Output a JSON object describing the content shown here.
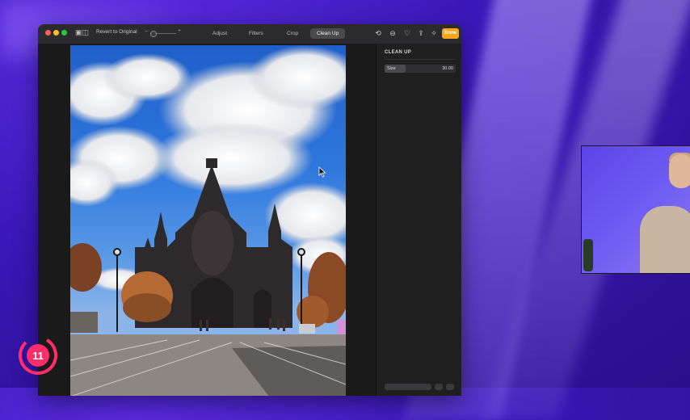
{
  "toolbar": {
    "revert_label": "Revert to Original",
    "zoom_minus": "–",
    "zoom_plus": "+",
    "tabs": [
      {
        "label": "Adjust"
      },
      {
        "label": "Filters"
      },
      {
        "label": "Crop"
      },
      {
        "label": "Clean Up",
        "active": true
      }
    ],
    "done_label": "Done",
    "icons": [
      "rotate-icon",
      "info-icon",
      "heart-icon",
      "share-icon",
      "magic-icon"
    ]
  },
  "panel": {
    "title": "CLEAN UP",
    "size_label": "Size",
    "size_value": "30.00",
    "size_fraction": 0.3
  },
  "overlay_logo": {
    "text": "11",
    "color": "#ff2d6a"
  },
  "colors": {
    "done": "#f7a51d",
    "window_bg": "#1e1e1f",
    "background_purple": "#3a17b8"
  }
}
